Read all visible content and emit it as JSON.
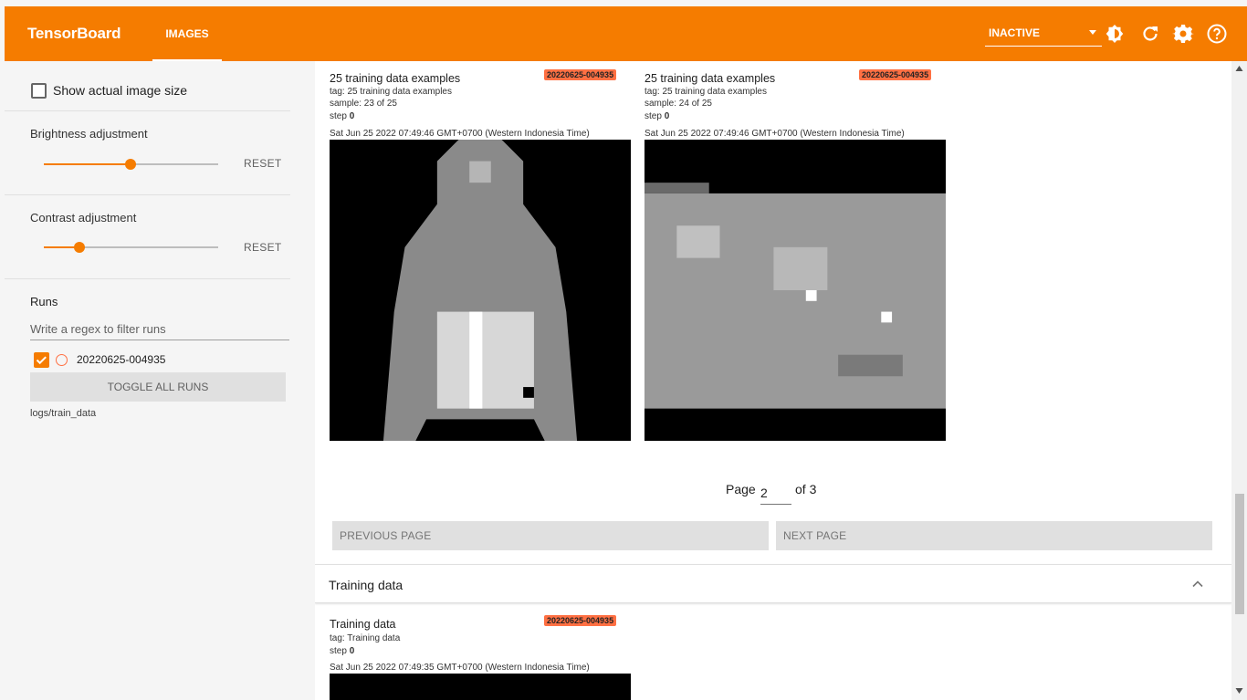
{
  "header": {
    "brand": "TensorBoard",
    "tab": "IMAGES",
    "status_select": "INACTIVE",
    "accent": "#f57c00"
  },
  "sidebar": {
    "show_actual_size": "Show actual image size",
    "brightness": {
      "label": "Brightness adjustment",
      "reset": "RESET",
      "value": 0.5
    },
    "contrast": {
      "label": "Contrast adjustment",
      "reset": "RESET",
      "value": 0.2
    },
    "runs": {
      "label": "Runs",
      "filter_placeholder": "Write a regex to filter runs",
      "run_name": "20220625-004935",
      "toggle_all": "TOGGLE ALL RUNS",
      "logdir": "logs/train_data"
    }
  },
  "cards": [
    {
      "title": "25 training data examples",
      "tag": "tag: 25 training data examples",
      "sample": "sample: 23 of 25",
      "step_label": "step",
      "step_value": "0",
      "timestamp": "Sat Jun 25 2022 07:49:46 GMT+0700 (Western Indonesia Time)",
      "run": "20220625-004935"
    },
    {
      "title": "25 training data examples",
      "tag": "tag: 25 training data examples",
      "sample": "sample: 24 of 25",
      "step_label": "step",
      "step_value": "0",
      "timestamp": "Sat Jun 25 2022 07:49:46 GMT+0700 (Western Indonesia Time)",
      "run": "20220625-004935"
    }
  ],
  "pager": {
    "page_label": "Page",
    "page_value": "2",
    "of_label": "of 3",
    "prev": "PREVIOUS PAGE",
    "next": "NEXT PAGE"
  },
  "training_section": {
    "title": "Training data",
    "card": {
      "title": "Training data",
      "tag": "tag: Training data",
      "step_label": "step",
      "step_value": "0",
      "timestamp": "Sat Jun 25 2022 07:49:35 GMT+0700 (Western Indonesia Time)",
      "run": "20220625-004935"
    }
  }
}
